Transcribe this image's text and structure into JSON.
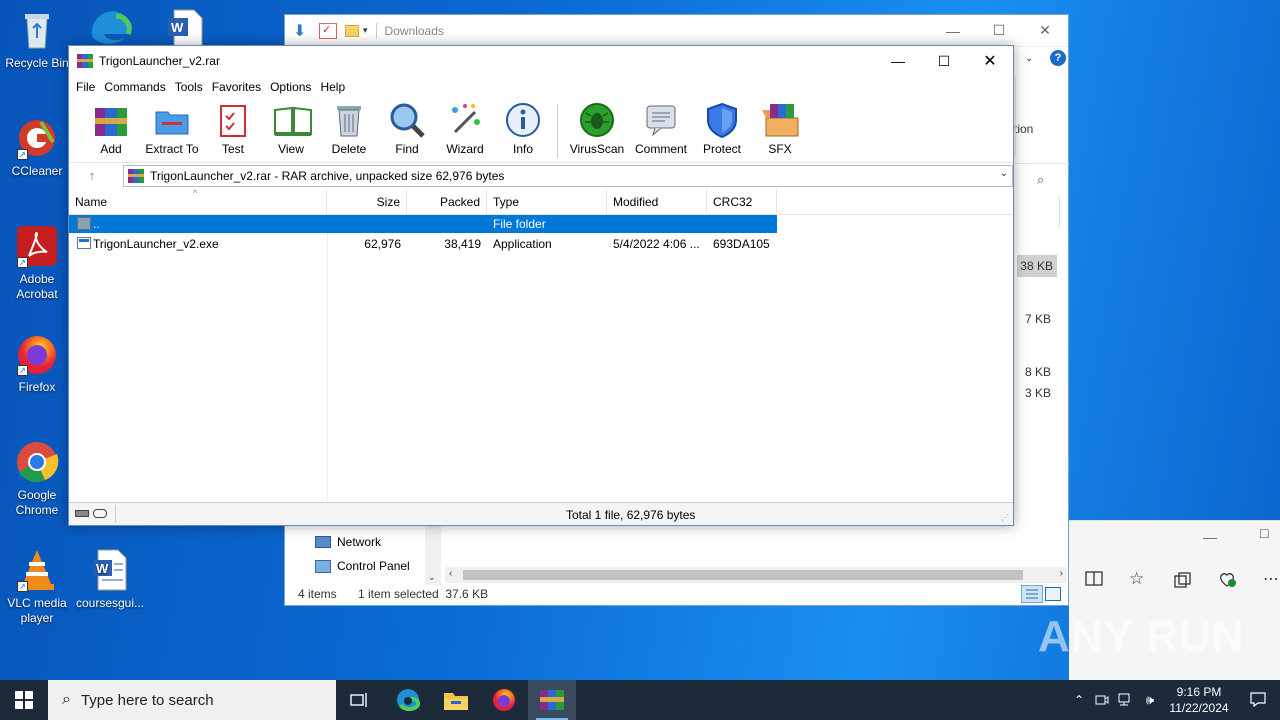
{
  "desktop": {
    "icons": [
      {
        "label": "Recycle Bin"
      },
      {
        "label": "CCleaner"
      },
      {
        "label": "Adobe Acrobat"
      },
      {
        "label": "Firefox"
      },
      {
        "label": "Google Chrome"
      },
      {
        "label": "VLC media player"
      },
      {
        "label": "coursesgui..."
      }
    ]
  },
  "explorer": {
    "title": "Downloads",
    "nav_items": [
      {
        "label": "Network"
      },
      {
        "label": "Control Panel"
      }
    ],
    "status_items": "4 items",
    "status_selected": "1 item selected  37.6 KB",
    "sizes": [
      "38 KB",
      "7 KB",
      "8 KB",
      "3 KB"
    ],
    "col_fragment": "tion"
  },
  "winrar": {
    "title": "TrigonLauncher_v2.rar",
    "menu": [
      "File",
      "Commands",
      "Tools",
      "Favorites",
      "Options",
      "Help"
    ],
    "toolbar": [
      "Add",
      "Extract To",
      "Test",
      "View",
      "Delete",
      "Find",
      "Wizard",
      "Info",
      "VirusScan",
      "Comment",
      "Protect",
      "SFX"
    ],
    "address": "TrigonLauncher_v2.rar - RAR archive, unpacked size 62,976 bytes",
    "columns": [
      "Name",
      "Size",
      "Packed",
      "Type",
      "Modified",
      "CRC32"
    ],
    "rows": [
      {
        "name": "..",
        "size": "",
        "packed": "",
        "type": "File folder",
        "modified": "",
        "crc": ""
      },
      {
        "name": "TrigonLauncher_v2.exe",
        "size": "62,976",
        "packed": "38,419",
        "type": "Application",
        "modified": "5/4/2022 4:06 ...",
        "crc": "693DA105"
      }
    ],
    "status": "Total 1 file, 62,976 bytes"
  },
  "taskbar": {
    "search_placeholder": "Type here to search",
    "time": "9:16 PM",
    "date": "11/22/2024"
  },
  "watermark": "ANY RUN"
}
